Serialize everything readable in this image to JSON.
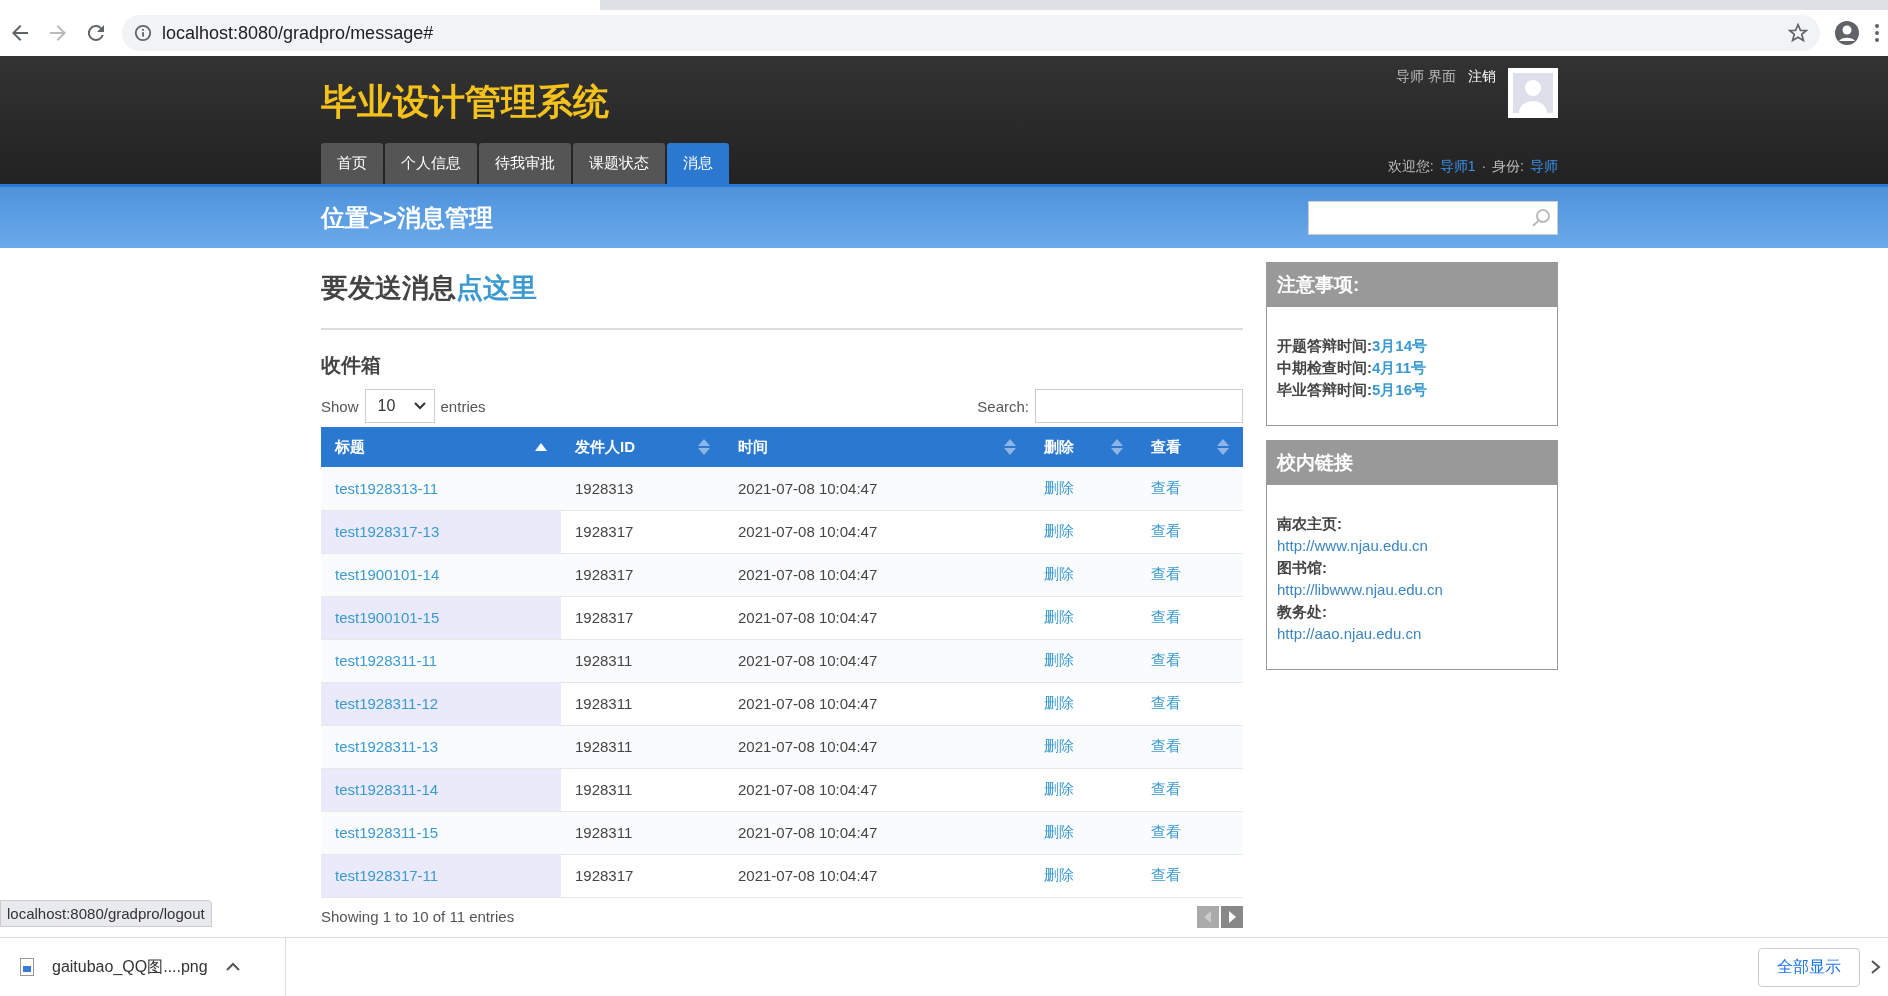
{
  "browser": {
    "url": "localhost:8080/gradpro/message#"
  },
  "header": {
    "logo": "毕业设计管理系统",
    "top_links": [
      "导师 界面",
      "注销"
    ],
    "nav": [
      {
        "label": "首页",
        "selected": false
      },
      {
        "label": "个人信息",
        "selected": false
      },
      {
        "label": "待我审批",
        "selected": false
      },
      {
        "label": "课题状态",
        "selected": false
      },
      {
        "label": "消息",
        "selected": true
      }
    ],
    "welcome_label": "欢迎您:",
    "user": "导师1",
    "separator": "·",
    "role_label": "身份:",
    "role": "导师"
  },
  "band": {
    "breadcrumb": "位置>>消息管理"
  },
  "compose": {
    "text": "要发送消息",
    "link": "点这里"
  },
  "inbox": {
    "title": "收件箱",
    "show_label": "Show",
    "page_size": "10",
    "entries_label": "entries",
    "search_label": "Search:",
    "columns": [
      {
        "label": "标题",
        "sorted": true
      },
      {
        "label": "发件人ID",
        "sorted": false
      },
      {
        "label": "时间",
        "sorted": false
      },
      {
        "label": "删除",
        "sorted": false
      },
      {
        "label": "查看",
        "sorted": false
      }
    ],
    "rows": [
      {
        "title": "test1928313-11",
        "sender": "1928313",
        "time": "2021-07-08 10:04:47",
        "delete": "删除",
        "view": "查看"
      },
      {
        "title": "test1928317-13",
        "sender": "1928317",
        "time": "2021-07-08 10:04:47",
        "delete": "删除",
        "view": "查看"
      },
      {
        "title": "test1900101-14",
        "sender": "1928317",
        "time": "2021-07-08 10:04:47",
        "delete": "删除",
        "view": "查看"
      },
      {
        "title": "test1900101-15",
        "sender": "1928317",
        "time": "2021-07-08 10:04:47",
        "delete": "删除",
        "view": "查看"
      },
      {
        "title": "test1928311-11",
        "sender": "1928311",
        "time": "2021-07-08 10:04:47",
        "delete": "删除",
        "view": "查看"
      },
      {
        "title": "test1928311-12",
        "sender": "1928311",
        "time": "2021-07-08 10:04:47",
        "delete": "删除",
        "view": "查看"
      },
      {
        "title": "test1928311-13",
        "sender": "1928311",
        "time": "2021-07-08 10:04:47",
        "delete": "删除",
        "view": "查看"
      },
      {
        "title": "test1928311-14",
        "sender": "1928311",
        "time": "2021-07-08 10:04:47",
        "delete": "删除",
        "view": "查看"
      },
      {
        "title": "test1928311-15",
        "sender": "1928311",
        "time": "2021-07-08 10:04:47",
        "delete": "删除",
        "view": "查看"
      },
      {
        "title": "test1928317-11",
        "sender": "1928317",
        "time": "2021-07-08 10:04:47",
        "delete": "删除",
        "view": "查看"
      }
    ],
    "info": "Showing 1 to 10 of 11 entries"
  },
  "notice": {
    "title": "注意事项:",
    "items": [
      {
        "label": "开题答辩时间:",
        "value": "3月14号"
      },
      {
        "label": "中期检查时间:",
        "value": "4月11号"
      },
      {
        "label": "毕业答辩时间:",
        "value": "5月16号"
      }
    ]
  },
  "links": {
    "title": "校内链接",
    "items": [
      {
        "label": "南农主页:",
        "url": "http://www.njau.edu.cn"
      },
      {
        "label": "图书馆:",
        "url": "http://libwww.njau.edu.cn"
      },
      {
        "label": "教务处:",
        "url": "http://aao.njau.edu.cn"
      }
    ]
  },
  "status_url": "localhost:8080/gradpro/logout",
  "downloads": {
    "file": "gaitubao_QQ图....png",
    "show_all": "全部显示"
  }
}
